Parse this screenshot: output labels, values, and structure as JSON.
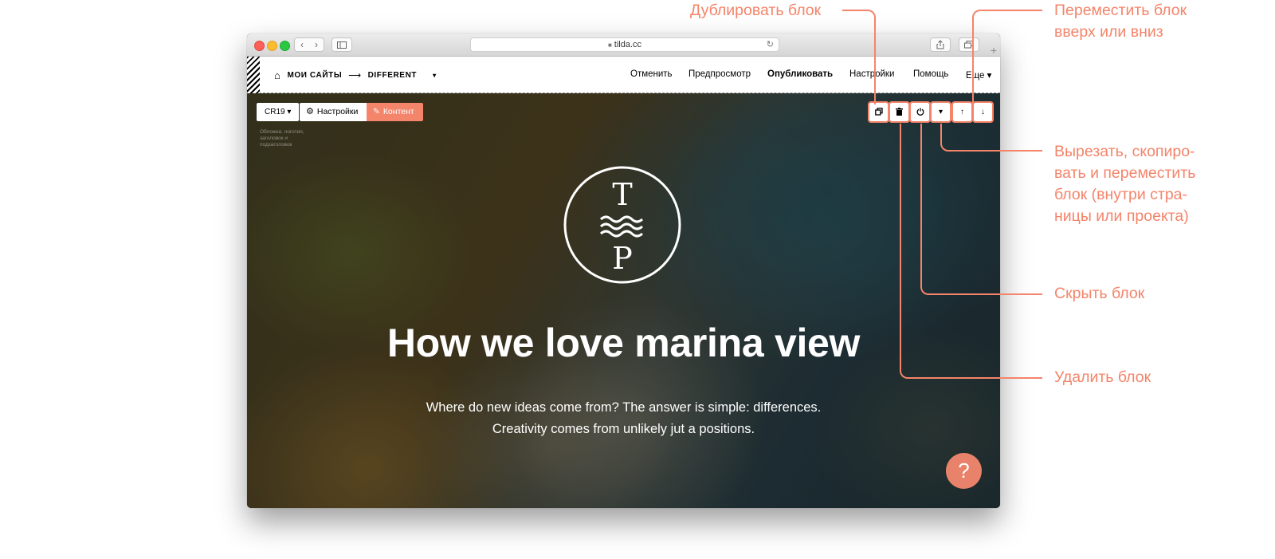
{
  "browser": {
    "url": "tilda.cc",
    "back_icon": "‹",
    "forward_icon": "›",
    "reload_icon": "↻",
    "plus_icon": "+"
  },
  "tilda_bar": {
    "home_icon": "⌂",
    "breadcrumb_root": "МОИ САЙТЫ",
    "breadcrumb_arrow": "⟶",
    "breadcrumb_current": "DIFFERENT",
    "breadcrumb_caret": "▾",
    "menu": [
      "Отменить",
      "Предпросмотр",
      "Опубликовать",
      "Настройки",
      "Помощь",
      "Еще ▾"
    ]
  },
  "block_toolbar": {
    "block_id": "CR19 ▾",
    "settings_label": "Настройки",
    "content_label": "Контент",
    "description": "Обложка: логотип, заголовок и подзаголовок",
    "down_caret": "▾",
    "up_arrow": "↑",
    "down_arrow": "↓"
  },
  "hero": {
    "logo_top": "T",
    "logo_bottom": "P",
    "title": "How we love marina view",
    "subtitle_line1": "Where do new ideas come from? The answer is simple: differences.",
    "subtitle_line2": "Creativity comes from unlikely jut a positions."
  },
  "help_button": {
    "label": "?"
  },
  "annotations": {
    "duplicate": "Дублировать блок",
    "move_line1": "Переместить блок",
    "move_line2": "вверх или вниз",
    "cut_line1": "Вырезать, скопиро-",
    "cut_line2": "вать и переместить",
    "cut_line3": "блок (внутри стра-",
    "cut_line4": "ницы или проекта)",
    "hide": "Скрыть блок",
    "delete": "Удалить блок"
  },
  "colors": {
    "accent": "#f4846a",
    "help_button": "#e8826a"
  }
}
